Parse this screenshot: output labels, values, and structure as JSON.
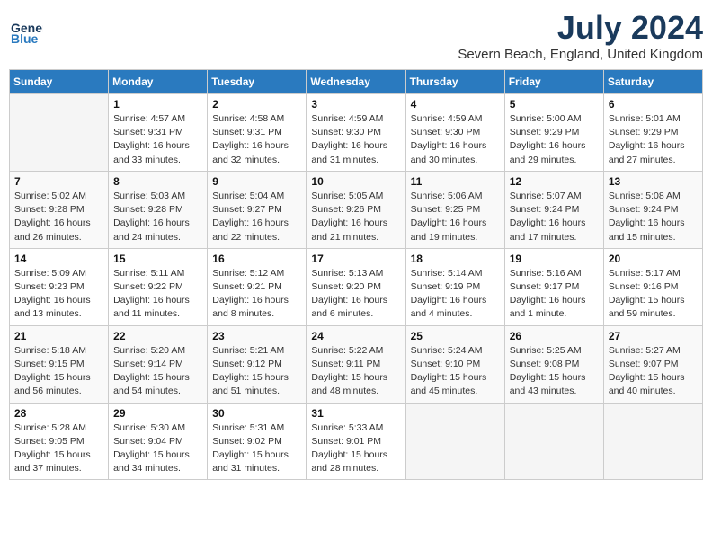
{
  "header": {
    "logo_general": "General",
    "logo_blue": "Blue",
    "month_year": "July 2024",
    "location": "Severn Beach, England, United Kingdom"
  },
  "days_of_week": [
    "Sunday",
    "Monday",
    "Tuesday",
    "Wednesday",
    "Thursday",
    "Friday",
    "Saturday"
  ],
  "weeks": [
    [
      {
        "day": "",
        "detail": ""
      },
      {
        "day": "1",
        "detail": "Sunrise: 4:57 AM\nSunset: 9:31 PM\nDaylight: 16 hours\nand 33 minutes."
      },
      {
        "day": "2",
        "detail": "Sunrise: 4:58 AM\nSunset: 9:31 PM\nDaylight: 16 hours\nand 32 minutes."
      },
      {
        "day": "3",
        "detail": "Sunrise: 4:59 AM\nSunset: 9:30 PM\nDaylight: 16 hours\nand 31 minutes."
      },
      {
        "day": "4",
        "detail": "Sunrise: 4:59 AM\nSunset: 9:30 PM\nDaylight: 16 hours\nand 30 minutes."
      },
      {
        "day": "5",
        "detail": "Sunrise: 5:00 AM\nSunset: 9:29 PM\nDaylight: 16 hours\nand 29 minutes."
      },
      {
        "day": "6",
        "detail": "Sunrise: 5:01 AM\nSunset: 9:29 PM\nDaylight: 16 hours\nand 27 minutes."
      }
    ],
    [
      {
        "day": "7",
        "detail": "Sunrise: 5:02 AM\nSunset: 9:28 PM\nDaylight: 16 hours\nand 26 minutes."
      },
      {
        "day": "8",
        "detail": "Sunrise: 5:03 AM\nSunset: 9:28 PM\nDaylight: 16 hours\nand 24 minutes."
      },
      {
        "day": "9",
        "detail": "Sunrise: 5:04 AM\nSunset: 9:27 PM\nDaylight: 16 hours\nand 22 minutes."
      },
      {
        "day": "10",
        "detail": "Sunrise: 5:05 AM\nSunset: 9:26 PM\nDaylight: 16 hours\nand 21 minutes."
      },
      {
        "day": "11",
        "detail": "Sunrise: 5:06 AM\nSunset: 9:25 PM\nDaylight: 16 hours\nand 19 minutes."
      },
      {
        "day": "12",
        "detail": "Sunrise: 5:07 AM\nSunset: 9:24 PM\nDaylight: 16 hours\nand 17 minutes."
      },
      {
        "day": "13",
        "detail": "Sunrise: 5:08 AM\nSunset: 9:24 PM\nDaylight: 16 hours\nand 15 minutes."
      }
    ],
    [
      {
        "day": "14",
        "detail": "Sunrise: 5:09 AM\nSunset: 9:23 PM\nDaylight: 16 hours\nand 13 minutes."
      },
      {
        "day": "15",
        "detail": "Sunrise: 5:11 AM\nSunset: 9:22 PM\nDaylight: 16 hours\nand 11 minutes."
      },
      {
        "day": "16",
        "detail": "Sunrise: 5:12 AM\nSunset: 9:21 PM\nDaylight: 16 hours\nand 8 minutes."
      },
      {
        "day": "17",
        "detail": "Sunrise: 5:13 AM\nSunset: 9:20 PM\nDaylight: 16 hours\nand 6 minutes."
      },
      {
        "day": "18",
        "detail": "Sunrise: 5:14 AM\nSunset: 9:19 PM\nDaylight: 16 hours\nand 4 minutes."
      },
      {
        "day": "19",
        "detail": "Sunrise: 5:16 AM\nSunset: 9:17 PM\nDaylight: 16 hours\nand 1 minute."
      },
      {
        "day": "20",
        "detail": "Sunrise: 5:17 AM\nSunset: 9:16 PM\nDaylight: 15 hours\nand 59 minutes."
      }
    ],
    [
      {
        "day": "21",
        "detail": "Sunrise: 5:18 AM\nSunset: 9:15 PM\nDaylight: 15 hours\nand 56 minutes."
      },
      {
        "day": "22",
        "detail": "Sunrise: 5:20 AM\nSunset: 9:14 PM\nDaylight: 15 hours\nand 54 minutes."
      },
      {
        "day": "23",
        "detail": "Sunrise: 5:21 AM\nSunset: 9:12 PM\nDaylight: 15 hours\nand 51 minutes."
      },
      {
        "day": "24",
        "detail": "Sunrise: 5:22 AM\nSunset: 9:11 PM\nDaylight: 15 hours\nand 48 minutes."
      },
      {
        "day": "25",
        "detail": "Sunrise: 5:24 AM\nSunset: 9:10 PM\nDaylight: 15 hours\nand 45 minutes."
      },
      {
        "day": "26",
        "detail": "Sunrise: 5:25 AM\nSunset: 9:08 PM\nDaylight: 15 hours\nand 43 minutes."
      },
      {
        "day": "27",
        "detail": "Sunrise: 5:27 AM\nSunset: 9:07 PM\nDaylight: 15 hours\nand 40 minutes."
      }
    ],
    [
      {
        "day": "28",
        "detail": "Sunrise: 5:28 AM\nSunset: 9:05 PM\nDaylight: 15 hours\nand 37 minutes."
      },
      {
        "day": "29",
        "detail": "Sunrise: 5:30 AM\nSunset: 9:04 PM\nDaylight: 15 hours\nand 34 minutes."
      },
      {
        "day": "30",
        "detail": "Sunrise: 5:31 AM\nSunset: 9:02 PM\nDaylight: 15 hours\nand 31 minutes."
      },
      {
        "day": "31",
        "detail": "Sunrise: 5:33 AM\nSunset: 9:01 PM\nDaylight: 15 hours\nand 28 minutes."
      },
      {
        "day": "",
        "detail": ""
      },
      {
        "day": "",
        "detail": ""
      },
      {
        "day": "",
        "detail": ""
      }
    ]
  ]
}
